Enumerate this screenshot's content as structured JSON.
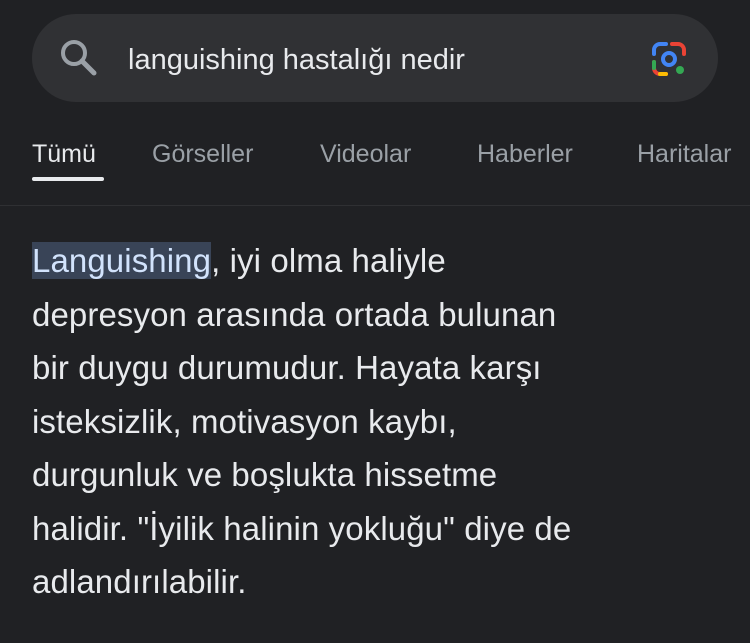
{
  "search": {
    "query": "languishing hastalığı nedir",
    "search_icon": "search-icon",
    "lens_icon": "google-lens-icon"
  },
  "tabs": [
    {
      "label": "Tümü",
      "active": true
    },
    {
      "label": "Görseller",
      "active": false
    },
    {
      "label": "Videolar",
      "active": false
    },
    {
      "label": "Haberler",
      "active": false
    },
    {
      "label": "Haritalar",
      "active": false
    }
  ],
  "answer": {
    "highlighted_term": "Languishing",
    "line1_rest": ", iyi olma haliyle",
    "line2": "depresyon arasında ortada bulunan",
    "line3": "bir duygu durumudur. Hayata karşı",
    "line4": "isteksizlik, motivasyon kaybı,",
    "line5": "durgunluk ve boşlukta hissetme",
    "line6": "halidir. \"İyilik halinin yokluğu\" diye de",
    "line7": "adlandırılabilir."
  },
  "colors": {
    "background": "#202124",
    "search_bar": "#303134",
    "text": "#e8eaed",
    "muted_text": "#9aa0a6",
    "highlight_bg": "#394457"
  }
}
